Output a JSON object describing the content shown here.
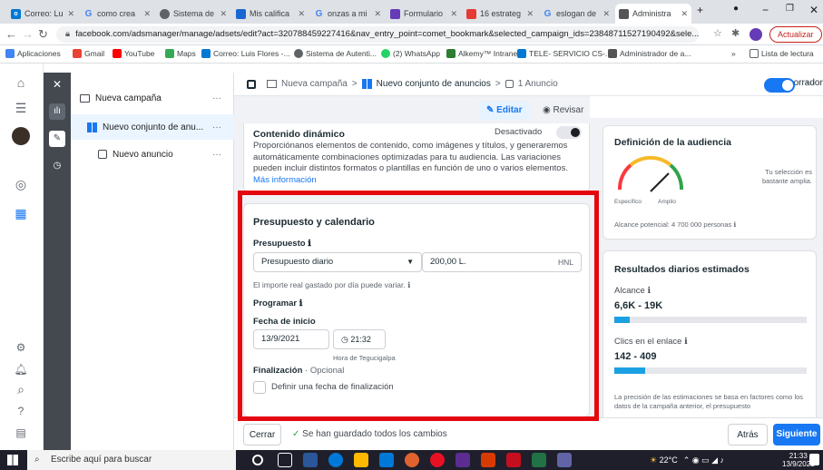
{
  "browser": {
    "tabs": [
      {
        "label": "Correo: Lui",
        "fav": "outlook-icon",
        "color": "#0078d4"
      },
      {
        "label": "como crea",
        "fav": "google-icon",
        "color": "#4285f4"
      },
      {
        "label": "Sistema de",
        "fav": "chrome-icon",
        "color": "#5f6368"
      },
      {
        "label": "Mis califica",
        "fav": "classroom-icon",
        "color": "#1967d2"
      },
      {
        "label": "onzas a mi",
        "fav": "google-icon",
        "color": "#4285f4"
      },
      {
        "label": "Formulario",
        "fav": "forms-icon",
        "color": "#673ab7"
      },
      {
        "label": "16 estrateg",
        "fav": "slides-icon",
        "color": "#e53935"
      },
      {
        "label": "eslogan de",
        "fav": "google-icon",
        "color": "#4285f4"
      },
      {
        "label": "Administra",
        "fav": "adsmanager-icon",
        "color": "#555"
      }
    ],
    "url": "facebook.com/adsmanager/manage/adsets/edit?act=320788459227416&nav_entry_point=comet_bookmark&selected_campaign_ids=23848711527190492&sele...",
    "update_label": "Actualizar",
    "bookmarks": [
      "Aplicaciones",
      "Gmail",
      "YouTube",
      "Maps",
      "Correo: Luis Flores -...",
      "Sistema de Autenti...",
      "(2) WhatsApp",
      "Alkemy™ Intranet",
      "TELE- SERVICIO CS-...",
      "Administrador de a..."
    ],
    "bookmarks_more": "»",
    "reading_list": "Lista de lectura"
  },
  "tree": {
    "campaign": "Nueva campaña",
    "adset": "Nuevo conjunto de anu...",
    "ad": "Nuevo anuncio",
    "dots": "···"
  },
  "header": {
    "crumb_campaign": "Nueva campaña",
    "crumb_adset": "Nuevo conjunto de anuncios",
    "crumb_ad": "1 Anuncio",
    "sep": ">",
    "status": "En borrador",
    "more": "···",
    "edit_label": "Editar",
    "review_label": "Revisar"
  },
  "dynamic": {
    "title": "Contenido dinámico",
    "toggle_label": "Desactivado",
    "desc": "Proporciónanos elementos de contenido, como imágenes y títulos, y generaremos automáticamente combinaciones optimizadas para tu audiencia. Las variaciones pueden incluir distintos formatos o plantillas en función de uno o varios elementos.",
    "more_link": "Más información"
  },
  "budget": {
    "section_title": "Presupuesto y calendario",
    "budget_label": "Presupuesto",
    "budget_type": "Presupuesto diario",
    "amount": "200,00 L.",
    "currency": "HNL",
    "budget_note": "El importe real gastado por día puede variar.",
    "schedule_label": "Programar",
    "start_label": "Fecha de inicio",
    "start_date": "13/9/2021",
    "start_time": "21:32",
    "timezone": "Hora de Tegucigalpa",
    "end_label": "Finalización",
    "end_optional": "· Opcional",
    "end_checkbox": "Definir una fecha de finalización"
  },
  "audience": {
    "title": "Definición de la audiencia",
    "gauge_note": "Tu selección es bastante amplia.",
    "specific": "Específico",
    "broad": "Amplio",
    "reach": "Alcance potencial: 4 700 000 personas"
  },
  "results": {
    "title": "Resultados diarios estimados",
    "reach_label": "Alcance",
    "reach_value": "6,6K - 19K",
    "reach_fill": 0.08,
    "clicks_label": "Clics en el enlace",
    "clicks_value": "142 - 409",
    "clicks_fill": 0.16,
    "note": "La precisión de las estimaciones se basa en factores como los datos de la campaña anterior, el presupuesto"
  },
  "footer": {
    "close_label": "Cerrar",
    "saved": "Se han guardado todos los cambios",
    "back_label": "Atrás",
    "next_label": "Siguiente"
  },
  "taskbar": {
    "search_placeholder": "Escribe aquí para buscar",
    "temp": "22°C",
    "time": "21:33",
    "date": "13/9/2021"
  },
  "colors": {
    "accent": "#1877f2",
    "highlight": "#e4070e",
    "success": "#31a24c"
  }
}
